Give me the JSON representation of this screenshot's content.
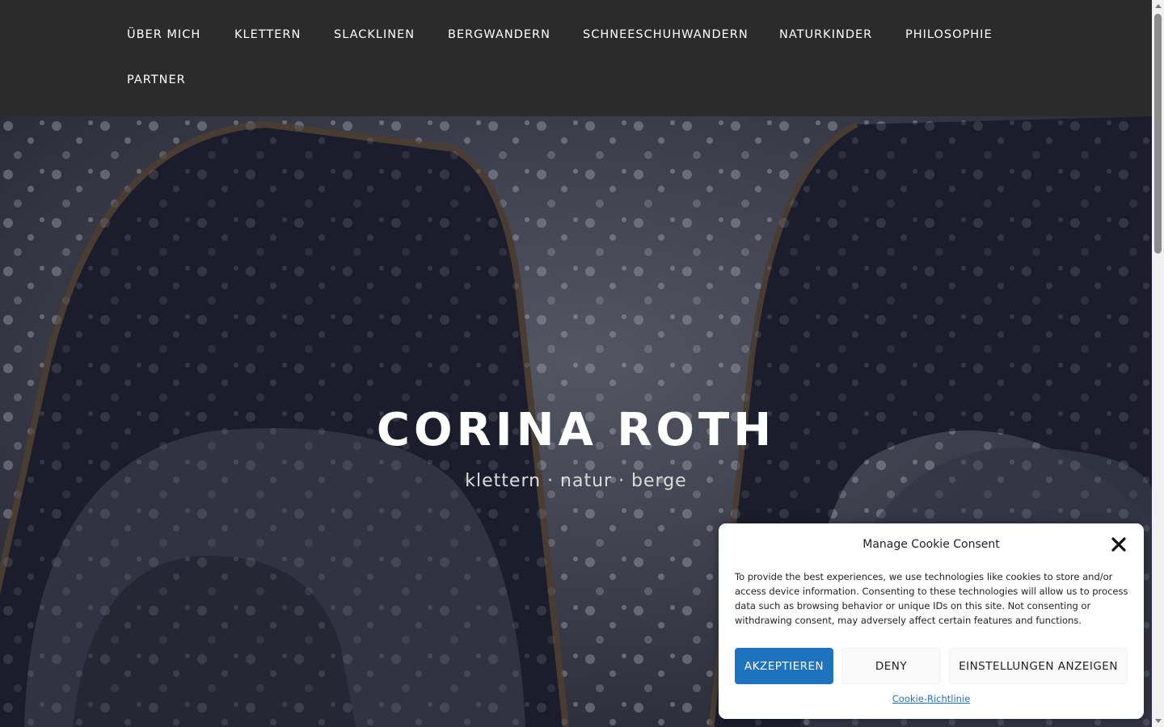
{
  "nav": {
    "items": [
      {
        "label": "ÜBER MICH"
      },
      {
        "label": "KLETTERN"
      },
      {
        "label": "SLACKLINEN"
      },
      {
        "label": "BERGWANDERN"
      },
      {
        "label": "SCHNEESCHUHWANDERN"
      },
      {
        "label": "NATURKINDER"
      },
      {
        "label": "PHILOSOPHIE"
      },
      {
        "label": "PARTNER"
      }
    ]
  },
  "hero": {
    "title": "CORINA ROTH",
    "tagline": "klettern · natur · berge"
  },
  "cookie": {
    "title": "Manage Cookie Consent",
    "text": "To provide the best experiences, we use technologies like cookies to store and/or access device information. Consenting to these technologies will allow us to process data such as browsing behavior or unique IDs on this site. Not consenting or withdrawing consent, may adversely affect certain features and functions.",
    "accept_label": "AKZEPTIEREN",
    "deny_label": "DENY",
    "prefs_label": "EINSTELLUNGEN ANZEIGEN",
    "policy_link": "Cookie-Richtlinie"
  },
  "colors": {
    "nav_bg": "#2b2b2b",
    "accent": "#1e73be"
  }
}
